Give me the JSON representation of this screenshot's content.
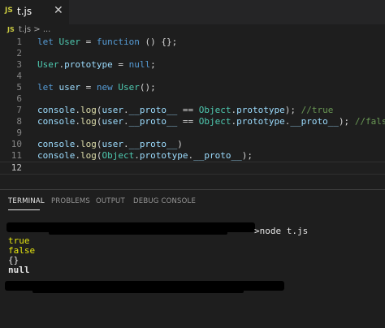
{
  "tab": {
    "icon": "JS",
    "label": "t.js",
    "close": "✕"
  },
  "breadcrumb": {
    "icon": "JS",
    "text": "t.js > ..."
  },
  "editor": {
    "line_numbers": [
      "1",
      "2",
      "3",
      "4",
      "5",
      "6",
      "7",
      "8",
      "9",
      "10",
      "11",
      "12"
    ],
    "lines": [
      [
        "let ",
        "User",
        " = ",
        "function",
        " () {};"
      ],
      [],
      [
        "User",
        ".",
        "prototype",
        " = ",
        "null",
        ";"
      ],
      [],
      [
        "let ",
        "user",
        " = ",
        "new ",
        "User",
        "();"
      ],
      [],
      [
        "console",
        ".",
        "log",
        "(",
        "user",
        ".",
        "__proto__",
        " == ",
        "Object",
        ".",
        "prototype",
        "); ",
        "//true"
      ],
      [
        "console",
        ".",
        "log",
        "(",
        "user",
        ".",
        "__proto__",
        " == ",
        "Object",
        ".",
        "prototype",
        ".",
        "__proto__",
        "); ",
        "//false"
      ],
      [],
      [
        "console",
        ".",
        "log",
        "(",
        "user",
        ".",
        "__proto__",
        ")"
      ],
      [
        "console",
        ".",
        "log",
        "(",
        "Object",
        ".",
        "prototype",
        ".",
        "__proto__",
        ");"
      ],
      []
    ]
  },
  "panel": {
    "tabs": [
      "TERMINAL",
      "PROBLEMS",
      "OUTPUT",
      "DEBUG CONSOLE"
    ],
    "active_tab": "TERMINAL"
  },
  "terminal": {
    "prompt_suffix": ">node t.js",
    "output": [
      "true",
      "false",
      "{}",
      "null"
    ]
  },
  "colors": {
    "background": "#1e1e1e",
    "keyword": "#569cd6",
    "variable": "#9cdcfe",
    "class": "#4ec9b0",
    "function": "#dcdcaa",
    "comment": "#6a9955",
    "terminal_yellow": "#e5e510"
  }
}
